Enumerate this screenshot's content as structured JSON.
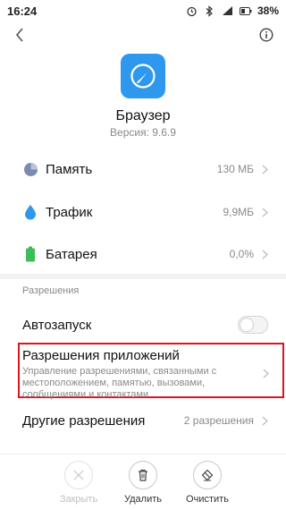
{
  "status_bar": {
    "time": "16:24",
    "battery_percent": "38%",
    "icons": [
      "alarm-icon",
      "bluetooth-icon",
      "signal-icon",
      "battery-icon"
    ]
  },
  "header": {
    "back_icon": "chevron-left-icon",
    "info_icon": "info-icon"
  },
  "app": {
    "name": "Браузер",
    "version": "Версия: 9.6.9",
    "icon_color": "#2e97ee"
  },
  "info_rows": [
    {
      "label": "Память",
      "value": "130 МБ",
      "icon": "pie-chart-icon"
    },
    {
      "label": "Трафик",
      "value": "9,9МБ",
      "icon": "drop-icon"
    },
    {
      "label": "Батарея",
      "value": "0,0%",
      "icon": "battery-icon"
    }
  ],
  "permissions": {
    "section_title": "Разрешения",
    "autostart": {
      "label": "Автозапуск",
      "enabled": false
    },
    "app_permissions": {
      "title": "Разрешения приложений",
      "description": "Управление разрешениями, связанными с местоположением, памятью, вызовами, сообщениями и контактами"
    },
    "other": {
      "label": "Другие разрешения",
      "value": "2 разрешения"
    }
  },
  "actions": [
    {
      "label": "Закрыть",
      "icon": "close-icon",
      "enabled": false
    },
    {
      "label": "Удалить",
      "icon": "trash-icon",
      "enabled": true
    },
    {
      "label": "Очистить",
      "icon": "eraser-icon",
      "enabled": true
    }
  ],
  "colors": {
    "accent_blue": "#2e97ee",
    "highlight_red": "#e0131f",
    "battery_green": "#3bbd5a"
  }
}
